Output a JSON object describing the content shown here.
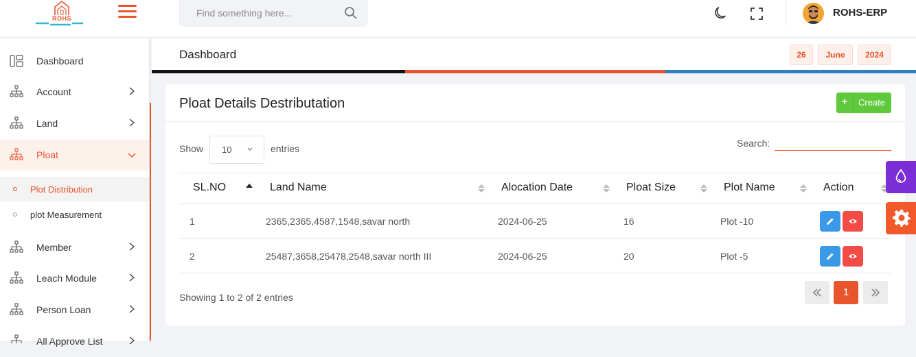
{
  "header": {
    "logo_text": "ROHS",
    "search_placeholder": "Find something here...",
    "username": "ROHS-ERP"
  },
  "sidebar": {
    "items": [
      {
        "label": "Dashboard",
        "icon": "dashboard-icon"
      },
      {
        "label": "Account",
        "icon": "sitemap-icon"
      },
      {
        "label": "Land",
        "icon": "sitemap-icon"
      },
      {
        "label": "Ploat",
        "icon": "sitemap-icon",
        "expanded": true
      },
      {
        "label": "Member",
        "icon": "sitemap-icon"
      },
      {
        "label": "Leach Module",
        "icon": "sitemap-icon"
      },
      {
        "label": "Person Loan",
        "icon": "sitemap-icon"
      },
      {
        "label": "All Approve List",
        "icon": "sitemap-icon"
      }
    ],
    "sub_items": [
      {
        "label": "Plot Distribution",
        "active": true
      },
      {
        "label": "plot Measurement",
        "active": false
      }
    ]
  },
  "page_bar": {
    "title": "Dashboard",
    "date_day": "26",
    "date_month": "June",
    "date_year": "2024"
  },
  "card": {
    "title": "Ploat Details Destributation",
    "create_label": "Create",
    "show_label": "Show",
    "entries_value": "10",
    "entries_label": "entries",
    "search_label": "Search:",
    "columns": [
      "SL.NO",
      "Land Name",
      "Alocation Date",
      "Ploat Size",
      "Plot Name",
      "Action"
    ],
    "rows": [
      {
        "sl": "1",
        "land": "2365,2365,4587,1548,savar north",
        "date": "2024-06-25",
        "size": "16",
        "plot": "Plot -10"
      },
      {
        "sl": "2",
        "land": "25487,3658,25478,2548,savar north III",
        "date": "2024-06-25",
        "size": "20",
        "plot": "Plot -5"
      }
    ],
    "showing_text": "Showing 1 to 2 of 2 entries",
    "current_page": "1"
  },
  "colors": {
    "accent": "#e8542c",
    "create_green": "#5fc93b",
    "edit_blue": "#3a9ae8",
    "view_red": "#f34b45",
    "theme_purple": "#7b2ed6"
  }
}
